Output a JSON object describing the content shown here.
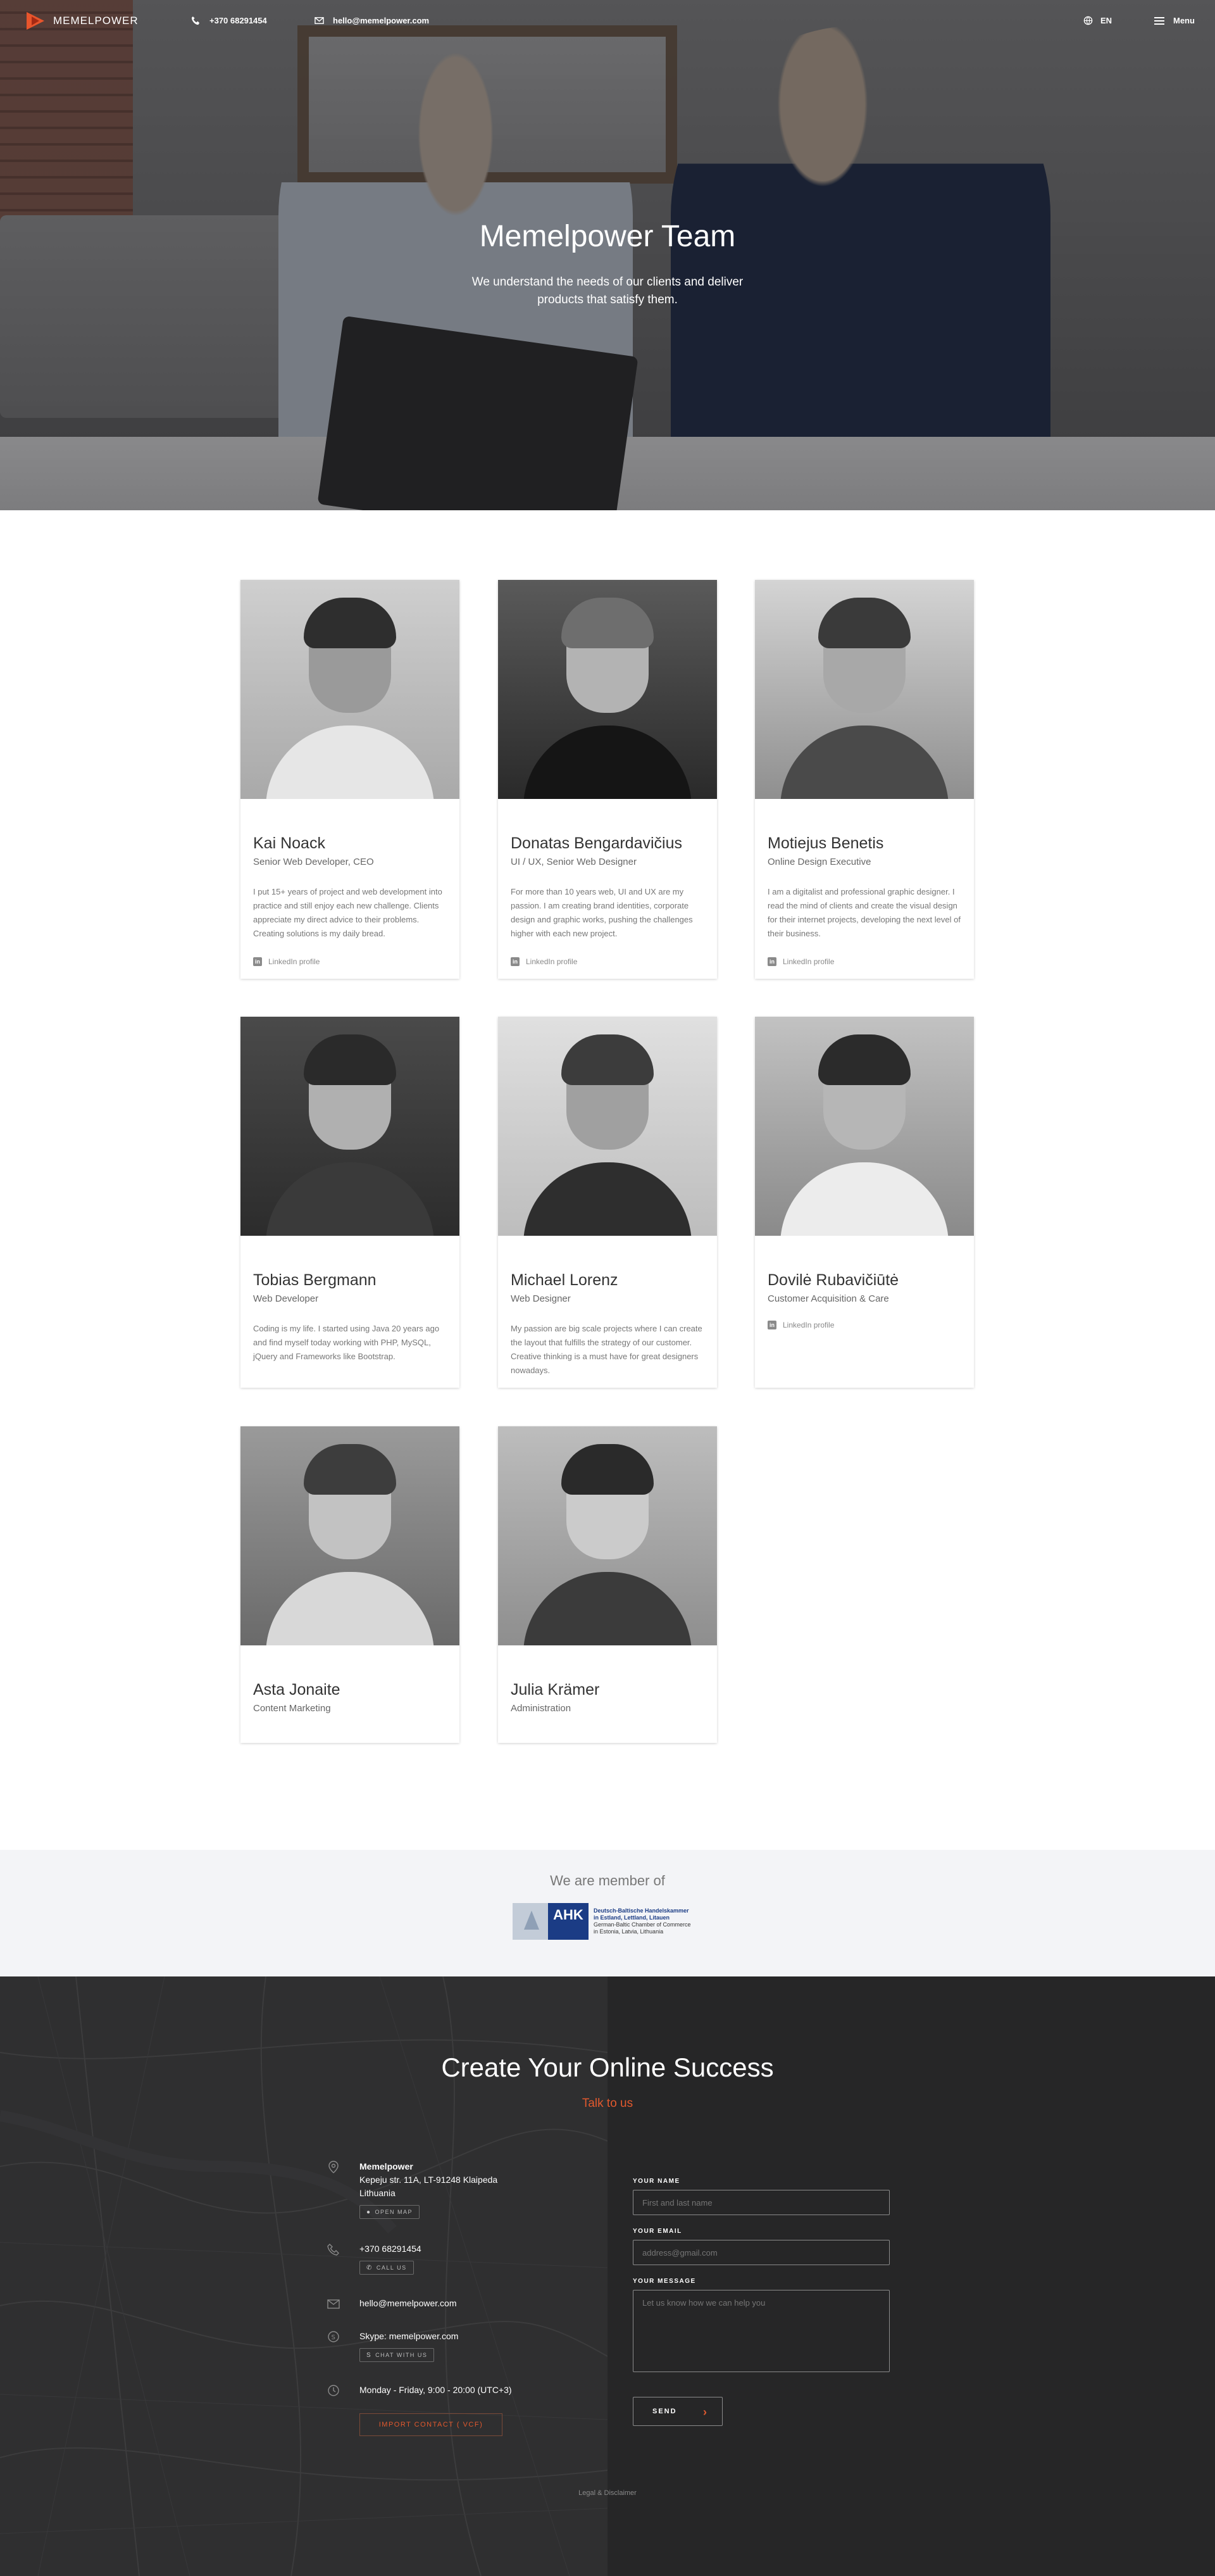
{
  "header": {
    "logo_text": "MEMELPOWER",
    "phone": "+370 68291454",
    "email": "hello@memelpower.com",
    "language": "EN",
    "menu_label": "Menu"
  },
  "hero": {
    "title": "Memelpower Team",
    "subtitle": "We understand the needs of our clients and deliver products that satisfy them."
  },
  "team": [
    {
      "name": "Kai Noack",
      "role": "Senior Web Developer, CEO",
      "bio": "I put 15+ years of project and web development into practice and still enjoy each new challenge. Clients appreciate my direct advice to their problems. Creating solutions is my daily bread.",
      "link": "LinkedIn profile"
    },
    {
      "name": "Donatas Bengardavičius",
      "role": "UI / UX, Senior Web Designer",
      "bio": "For more than 10 years web, UI and UX are my passion. I am creating brand identities, corporate design and graphic works, pushing the challenges higher with each new project.",
      "link": "LinkedIn profile"
    },
    {
      "name": "Motiejus Benetis",
      "role": "Online Design Executive",
      "bio": "I am a digitalist and professional graphic designer. I read the mind of clients and create the visual design for their internet projects, developing the next level of their business.",
      "link": "LinkedIn profile"
    },
    {
      "name": "Tobias Bergmann",
      "role": "Web Developer",
      "bio": "Coding is my life. I started using Java 20 years ago and find myself today working with PHP, MySQL, jQuery and Frameworks like Bootstrap.",
      "link": ""
    },
    {
      "name": "Michael Lorenz",
      "role": "Web Designer",
      "bio": "My passion are big scale projects where I can create the layout that fulfills the strategy of our customer. Creative thinking is a must have for great designers nowadays.",
      "link": ""
    },
    {
      "name": "Dovilė Rubavičiūtė",
      "role": "Customer Acquisition & Care",
      "bio": "",
      "link": "LinkedIn profile"
    },
    {
      "name": "Asta Jonaite",
      "role": "Content Marketing",
      "bio": "",
      "link": ""
    },
    {
      "name": "Julia Krämer",
      "role": "Administration",
      "bio": "",
      "link": ""
    }
  ],
  "member": {
    "title": "We are member of",
    "logo_abbr": "AHK",
    "logo_line1": "Deutsch-Baltische Handelskammer",
    "logo_line2": "in Estland, Lettland, Litauen",
    "logo_line3": "German-Baltic Chamber of Commerce",
    "logo_line4": "in Estonia, Latvia, Lithuania"
  },
  "contact": {
    "title": "Create Your Online Success",
    "subtitle": "Talk to us",
    "company": "Memelpower",
    "address": "Kepeju str. 11A, LT-91248 Klaipeda",
    "country": "Lithuania",
    "open_map": "OPEN MAP",
    "phone": "+370 68291454",
    "call_us": "CALL US",
    "email": "hello@memelpower.com",
    "skype": "Skype: memelpower.com",
    "chat": "CHAT WITH US",
    "hours": "Monday - Friday, 9:00 - 20:00 (UTC+3)",
    "vcf": "IMPORT CONTACT ( VCF)",
    "form": {
      "name_label": "YOUR NAME",
      "name_placeholder": "First and last name",
      "email_label": "YOUR EMAIL",
      "email_placeholder": "address@gmail.com",
      "message_label": "YOUR MESSAGE",
      "message_placeholder": "Let us know how we can help you",
      "send": "SEND"
    },
    "legal": "Legal & Disclaimer"
  },
  "colors": {
    "accent": "#e2592e",
    "dark": "#262627",
    "member_bg": "#f3f4f7",
    "ahk_blue": "#1b3c85"
  }
}
